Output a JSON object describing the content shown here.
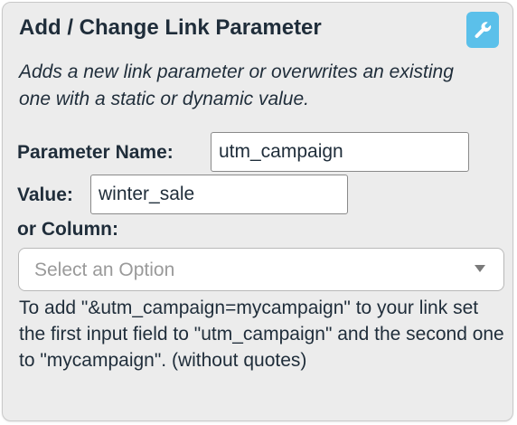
{
  "card": {
    "title": "Add / Change Link Parameter",
    "description": "Adds a new link parameter or overwrites an existing one with a static or dynamic value.",
    "action_icon": "wrench-icon",
    "colors": {
      "accent": "#5bc0ea",
      "background": "#ececec",
      "text": "#1f2d3a"
    }
  },
  "form": {
    "parameter_name_label": "Parameter Name:",
    "parameter_name_value": "utm_campaign",
    "value_label": "Value:",
    "value_value": "winter_sale",
    "column_label": "or Column:",
    "column_placeholder": "Select an Option"
  },
  "help_text": "To add \"&utm_campaign=mycampaign\" to your link set the first input field to \"utm_campaign\" and the second one to \"mycampaign\". (without quotes)"
}
